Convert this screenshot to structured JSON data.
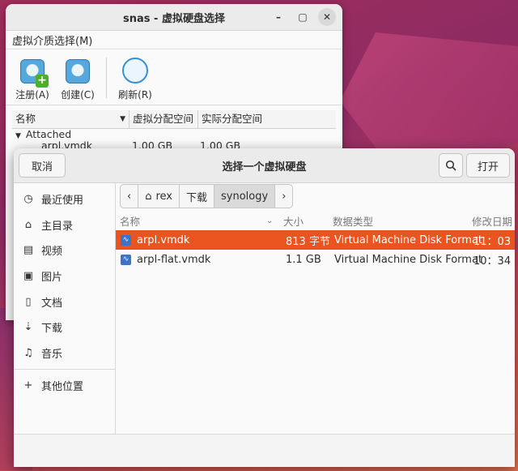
{
  "back_window": {
    "title": "snas - 虚拟硬盘选择",
    "menu": "虚拟介质选择(M)",
    "toolbar": [
      {
        "label": "注册(A)",
        "icon": "register-disk-icon"
      },
      {
        "label": "创建(C)",
        "icon": "create-disk-icon"
      },
      {
        "label": "刷新(R)",
        "icon": "refresh-icon"
      }
    ],
    "columns": [
      "名称",
      "虚拟分配空间",
      "实际分配空间"
    ],
    "group": "Attached",
    "rows": [
      {
        "name": "arpl.vmdk",
        "virtual": "1.00 GB",
        "actual": "1.00 GB"
      }
    ],
    "minimize": "–",
    "maximize": "▢",
    "close": "✕"
  },
  "dialog": {
    "title": "选择一个虚拟硬盘",
    "cancel_label": "取消",
    "open_label": "打开",
    "sidebar": [
      {
        "label": "最近使用",
        "icon": "clock-icon"
      },
      {
        "label": "主目录",
        "icon": "home-icon"
      },
      {
        "label": "视频",
        "icon": "video-icon"
      },
      {
        "label": "图片",
        "icon": "image-icon"
      },
      {
        "label": "文档",
        "icon": "document-icon"
      },
      {
        "label": "下载",
        "icon": "download-icon"
      },
      {
        "label": "音乐",
        "icon": "music-icon"
      },
      {
        "label": "其他位置",
        "icon": "plus-icon"
      }
    ],
    "path": [
      "rex",
      "下载",
      "synology"
    ],
    "columns": {
      "name": "名称",
      "size": "大小",
      "type": "数据类型",
      "date": "修改日期"
    },
    "files": [
      {
        "name": "arpl.vmdk",
        "size": "813 字节",
        "type": "Virtual Machine Disk Format",
        "date": "11：03",
        "selected": true
      },
      {
        "name": "arpl-flat.vmdk",
        "size": "1.1 GB",
        "type": "Virtual Machine Disk Format",
        "date": "10：34",
        "selected": false
      }
    ]
  }
}
